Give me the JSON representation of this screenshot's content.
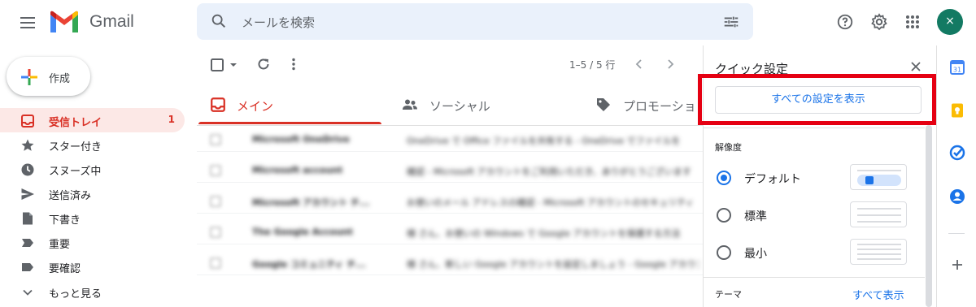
{
  "header": {
    "app_name": "Gmail",
    "search_placeholder": "メールを検索",
    "avatar_initial": "×"
  },
  "sidebar": {
    "compose_label": "作成",
    "items": [
      {
        "label": "受信トレイ",
        "count": "1",
        "icon": "inbox-icon",
        "active": true
      },
      {
        "label": "スター付き",
        "count": "",
        "icon": "star-icon"
      },
      {
        "label": "スヌーズ中",
        "count": "",
        "icon": "clock-icon"
      },
      {
        "label": "送信済み",
        "count": "",
        "icon": "send-icon"
      },
      {
        "label": "下書き",
        "count": "",
        "icon": "draft-icon"
      },
      {
        "label": "重要",
        "count": "",
        "icon": "label-important-icon"
      },
      {
        "label": "要確認",
        "count": "",
        "icon": "label-icon"
      },
      {
        "label": "もっと見る",
        "count": "",
        "icon": "chevron-down-icon"
      }
    ]
  },
  "toolbar": {
    "page_count": "1–5 / 5 行"
  },
  "tabs": [
    {
      "label": "メイン",
      "icon": "inbox-icon",
      "active": true
    },
    {
      "label": "ソーシャル",
      "icon": "people-icon"
    },
    {
      "label": "プロモーショ",
      "icon": "tag-icon"
    }
  ],
  "emails": [
    {
      "from": "Microsoft OneDrive",
      "subject": "OneDrive で Office ファイルを共有する - OneDrive でファイルを",
      "date": ""
    },
    {
      "from": "Microsoft account",
      "subject": "確認 - Microsoft アカウントをご利用いただき、ありがとうございます",
      "date": ""
    },
    {
      "from": "Microsoft アカウント チ...",
      "subject": "お使いのメール アドレスの確認 - Microsoft アカウントのセキュリティ",
      "date": ""
    },
    {
      "from": "The Google Account",
      "subject": "様 さん、お使いの Windows で Google アカウントを保護する方法",
      "date": ""
    },
    {
      "from": "Google コミュニティ チ...",
      "subject": "様 さん、新しい Google アカウントを設定しましょう - Google アカウント",
      "date": ""
    }
  ],
  "quick_settings": {
    "title": "クイック設定",
    "see_all_label": "すべての設定を表示",
    "density_heading": "解像度",
    "density_options": [
      {
        "label": "デフォルト",
        "selected": true
      },
      {
        "label": "標準",
        "selected": false
      },
      {
        "label": "最小",
        "selected": false
      }
    ],
    "theme_heading": "テーマ",
    "theme_see_all": "すべて表示"
  },
  "colors": {
    "accent_red": "#d93025",
    "link_blue": "#1a73e8",
    "highlight_box": "#e50012",
    "avatar_bg": "#137a63"
  }
}
